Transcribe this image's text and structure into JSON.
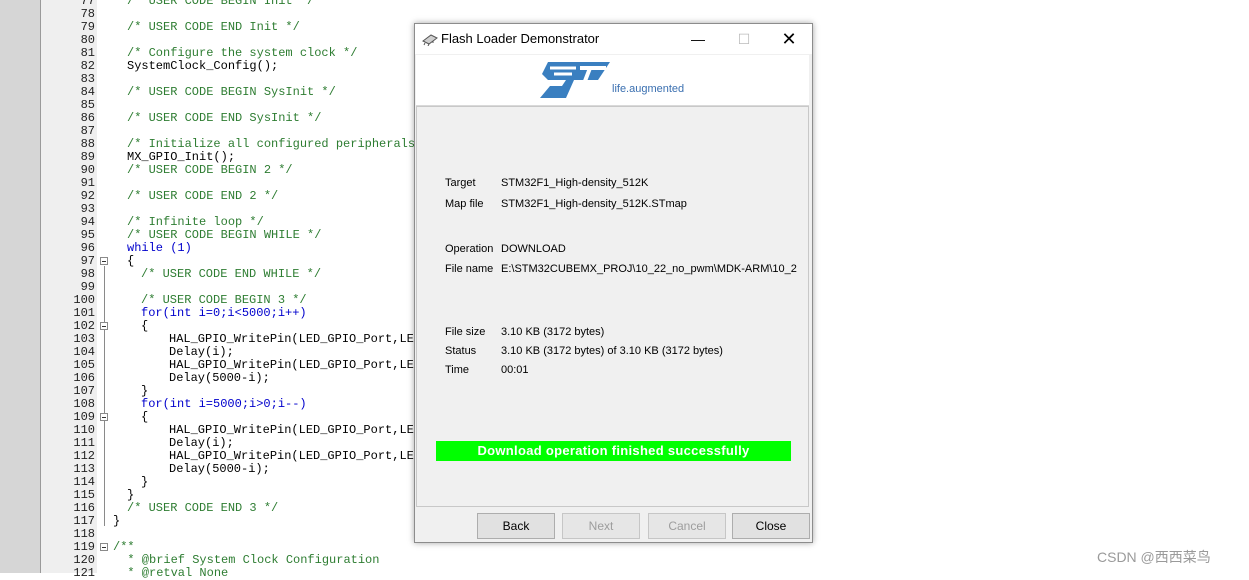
{
  "editor": {
    "lines": [
      {
        "n": "77",
        "text": "/* USER CODE BEGIN Init */",
        "type": "comment",
        "indent": 1,
        "fold": false
      },
      {
        "n": "78",
        "text": "",
        "type": "normal",
        "indent": 0,
        "fold": false
      },
      {
        "n": "79",
        "text": "/* USER CODE END Init */",
        "type": "comment",
        "indent": 1,
        "fold": false
      },
      {
        "n": "80",
        "text": "",
        "type": "normal",
        "indent": 0,
        "fold": false
      },
      {
        "n": "81",
        "text": "/* Configure the system clock */",
        "type": "comment",
        "indent": 1,
        "fold": false
      },
      {
        "n": "82",
        "text": "SystemClock_Config();",
        "type": "normal",
        "indent": 1,
        "fold": false
      },
      {
        "n": "83",
        "text": "",
        "type": "normal",
        "indent": 0,
        "fold": false
      },
      {
        "n": "84",
        "text": "/* USER CODE BEGIN SysInit */",
        "type": "comment",
        "indent": 1,
        "fold": false
      },
      {
        "n": "85",
        "text": "",
        "type": "normal",
        "indent": 0,
        "fold": false
      },
      {
        "n": "86",
        "text": "/* USER CODE END SysInit */",
        "type": "comment",
        "indent": 1,
        "fold": false
      },
      {
        "n": "87",
        "text": "",
        "type": "normal",
        "indent": 0,
        "fold": false
      },
      {
        "n": "88",
        "text": "/* Initialize all configured peripherals */",
        "type": "comment",
        "indent": 1,
        "fold": false
      },
      {
        "n": "89",
        "text": "MX_GPIO_Init();",
        "type": "normal",
        "indent": 1,
        "fold": false
      },
      {
        "n": "90",
        "text": "/* USER CODE BEGIN 2 */",
        "type": "comment",
        "indent": 1,
        "fold": false
      },
      {
        "n": "91",
        "text": "",
        "type": "normal",
        "indent": 0,
        "fold": false
      },
      {
        "n": "92",
        "text": "/* USER CODE END 2 */",
        "type": "comment",
        "indent": 1,
        "fold": false
      },
      {
        "n": "93",
        "text": "",
        "type": "normal",
        "indent": 0,
        "fold": false
      },
      {
        "n": "94",
        "text": "/* Infinite loop */",
        "type": "comment",
        "indent": 1,
        "fold": false
      },
      {
        "n": "95",
        "text": "/* USER CODE BEGIN WHILE */",
        "type": "comment",
        "indent": 1,
        "fold": false
      },
      {
        "n": "96",
        "text": "while (1)",
        "type": "kw",
        "indent": 1,
        "fold": false
      },
      {
        "n": "97",
        "text": "{",
        "type": "normal",
        "indent": 1,
        "fold": true
      },
      {
        "n": "98",
        "text": "/* USER CODE END WHILE */",
        "type": "comment",
        "indent": 2,
        "fold": false
      },
      {
        "n": "99",
        "text": "",
        "type": "normal",
        "indent": 0,
        "fold": false
      },
      {
        "n": "100",
        "text": "/* USER CODE BEGIN 3 */",
        "type": "comment",
        "indent": 2,
        "fold": false
      },
      {
        "n": "101",
        "text": "for(int i=0;i<5000;i++)",
        "type": "kw",
        "indent": 2,
        "fold": false
      },
      {
        "n": "102",
        "text": "{",
        "type": "normal",
        "indent": 2,
        "fold": true
      },
      {
        "n": "103",
        "text": "HAL_GPIO_WritePin(LED_GPIO_Port,LED",
        "type": "normal",
        "indent": 4,
        "fold": false
      },
      {
        "n": "104",
        "text": "Delay(i);",
        "type": "normal",
        "indent": 4,
        "fold": false
      },
      {
        "n": "105",
        "text": "HAL_GPIO_WritePin(LED_GPIO_Port,LED",
        "type": "normal",
        "indent": 4,
        "fold": false
      },
      {
        "n": "106",
        "text": "Delay(5000-i);",
        "type": "normal",
        "indent": 4,
        "fold": false
      },
      {
        "n": "107",
        "text": "}",
        "type": "normal",
        "indent": 2,
        "fold": false
      },
      {
        "n": "108",
        "text": "for(int i=5000;i>0;i--)",
        "type": "kw",
        "indent": 2,
        "fold": false
      },
      {
        "n": "109",
        "text": "{",
        "type": "normal",
        "indent": 2,
        "fold": true
      },
      {
        "n": "110",
        "text": "HAL_GPIO_WritePin(LED_GPIO_Port,LED",
        "type": "normal",
        "indent": 4,
        "fold": false
      },
      {
        "n": "111",
        "text": "Delay(i);",
        "type": "normal",
        "indent": 4,
        "fold": false
      },
      {
        "n": "112",
        "text": "HAL_GPIO_WritePin(LED_GPIO_Port,LED",
        "type": "normal",
        "indent": 4,
        "fold": false
      },
      {
        "n": "113",
        "text": "Delay(5000-i);",
        "type": "normal",
        "indent": 4,
        "fold": false
      },
      {
        "n": "114",
        "text": "}",
        "type": "normal",
        "indent": 2,
        "fold": false
      },
      {
        "n": "115",
        "text": "}",
        "type": "normal",
        "indent": 1,
        "fold": false
      },
      {
        "n": "116",
        "text": "/* USER CODE END 3 */",
        "type": "comment",
        "indent": 1,
        "fold": false
      },
      {
        "n": "117",
        "text": "}",
        "type": "normal",
        "indent": 0,
        "fold": false
      },
      {
        "n": "118",
        "text": "",
        "type": "normal",
        "indent": 0,
        "fold": false
      },
      {
        "n": "119",
        "text": "/**",
        "type": "comment",
        "indent": 0,
        "fold": true
      },
      {
        "n": "120",
        "text": "  * @brief System Clock Configuration",
        "type": "comment",
        "indent": 0,
        "fold": false
      },
      {
        "n": "121",
        "text": "  * @retval None",
        "type": "comment",
        "indent": 0,
        "fold": false
      }
    ]
  },
  "dialog": {
    "title": "Flash Loader Demonstrator",
    "minimize_glyph": "—",
    "maximize_glyph": "☐",
    "close_glyph": "✕",
    "logo_tagline": "life.augmented",
    "target_label": "Target",
    "target_value": "STM32F1_High-density_512K",
    "mapfile_label": "Map file",
    "mapfile_value": "STM32F1_High-density_512K.STmap",
    "operation_label": "Operation",
    "operation_value": "DOWNLOAD",
    "filename_label": "File name",
    "filename_value": "E:\\STM32CUBEMX_PROJ\\10_22_no_pwm\\MDK-ARM\\10_2",
    "filesize_label": "File size",
    "filesize_value": "3.10 KB (3172 bytes)",
    "status_label": "Status",
    "status_value": "3.10 KB (3172 bytes) of 3.10 KB (3172 bytes)",
    "time_label": "Time",
    "time_value": "00:01",
    "progress_text": "Download operation finished successfully",
    "progress_fraction": 1.0,
    "progress_color": "#00ff00",
    "buttons": {
      "back": "Back",
      "next": "Next",
      "cancel": "Cancel",
      "close": "Close"
    }
  },
  "watermark": "CSDN @西西菜鸟",
  "colors": {
    "comment": "#2e7d32",
    "keyword": "#0000cc",
    "logo_blue": "#3a7fc0"
  }
}
